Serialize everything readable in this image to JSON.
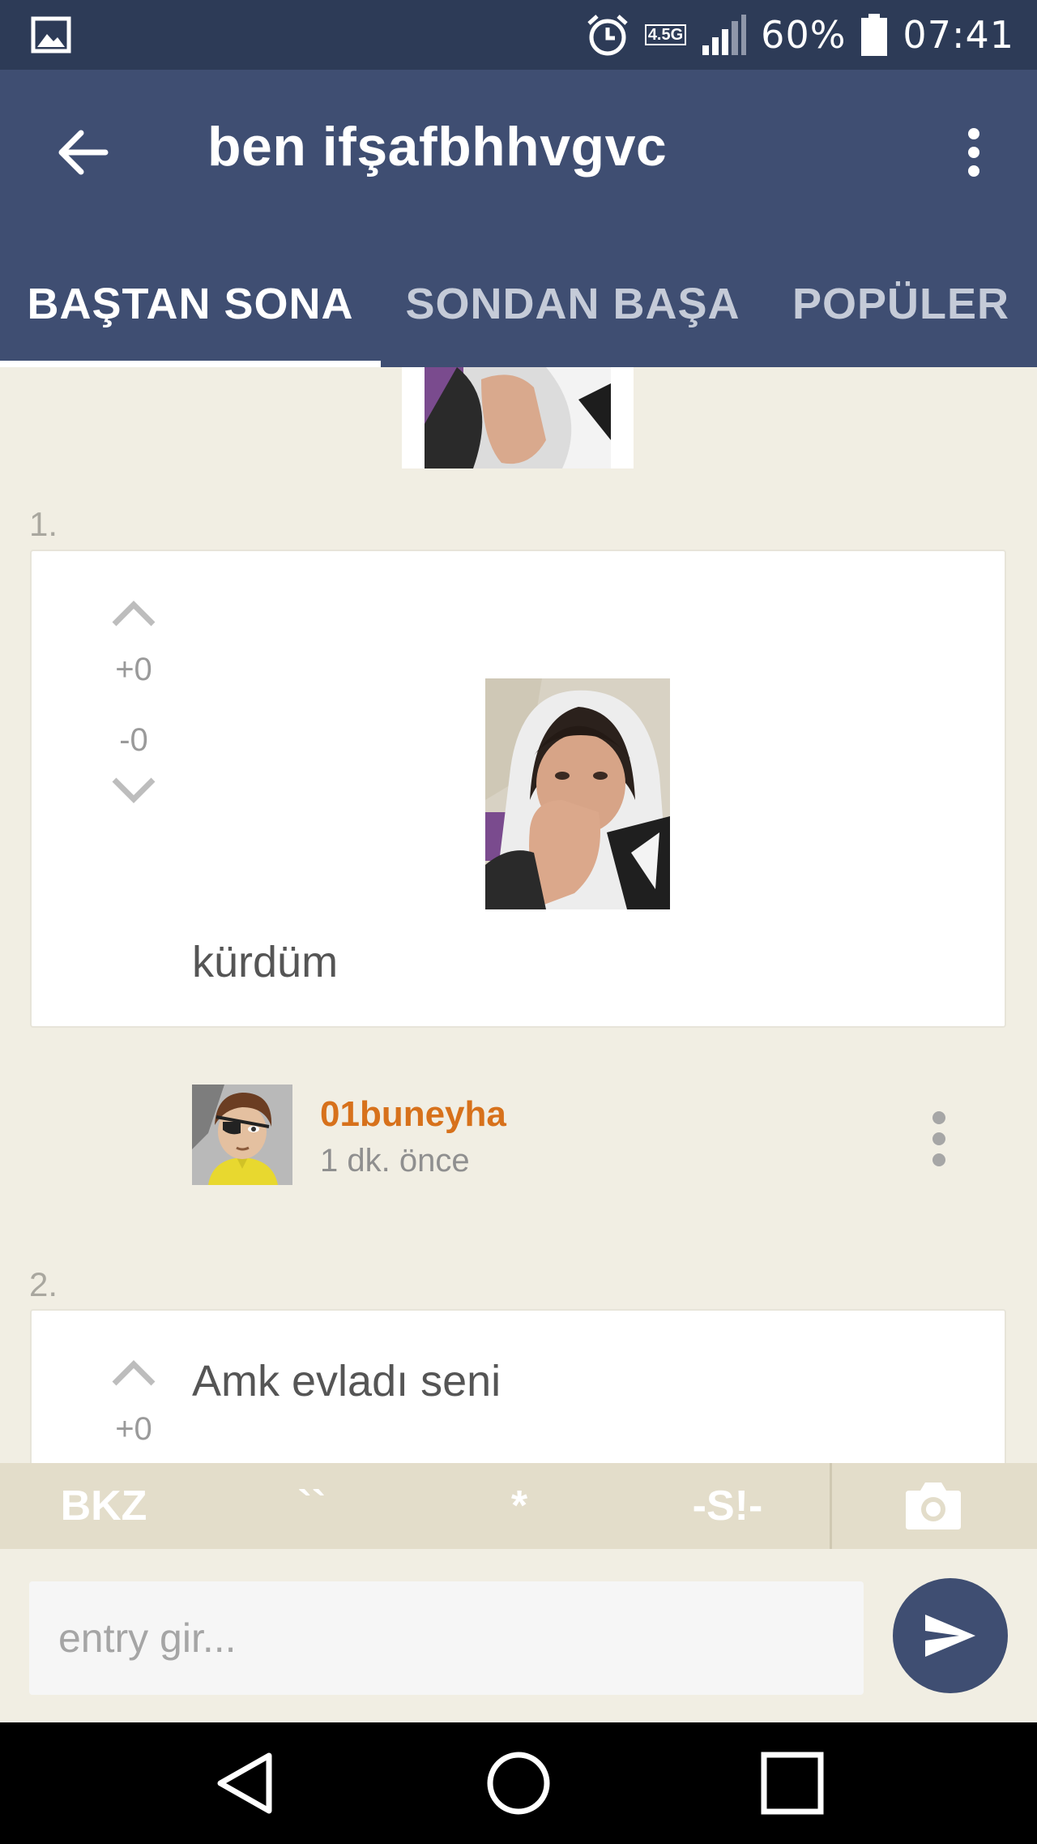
{
  "status_bar": {
    "network": "4.5G",
    "battery": "60%",
    "time": "07:41"
  },
  "app_bar": {
    "title": "ben ifşafbhhvgvc"
  },
  "tabs": [
    {
      "label": "BAŞTAN SONA",
      "active": true
    },
    {
      "label": "SONDAN BAŞA",
      "active": false
    },
    {
      "label": "POPÜLER",
      "active": false
    }
  ],
  "entries": [
    {
      "index": "1.",
      "upvotes": "+0",
      "downvotes": "-0",
      "text": "kürdüm",
      "author": "01buneyha",
      "time": "1 dk. önce"
    },
    {
      "index": "2.",
      "upvotes": "+0",
      "text": "Amk evladı seni"
    }
  ],
  "toolbar": {
    "bkz": "BKZ",
    "backtick": "``",
    "star": "*",
    "spoiler": "-S!-"
  },
  "composer": {
    "placeholder": "entry gir..."
  },
  "colors": {
    "status_bar": "#2d3b57",
    "app_bar": "#3f4e72",
    "page_bg": "#f1eee3",
    "author": "#d7711b",
    "toolbar": "#e3ddca"
  },
  "icons": {
    "status": [
      "gallery-icon",
      "alarm-icon",
      "signal-icon",
      "battery-icon"
    ],
    "app_bar": [
      "back-arrow-icon",
      "more-vert-icon"
    ],
    "entry": [
      "upvote-chevron-icon",
      "downvote-chevron-icon",
      "more-vert-icon"
    ],
    "toolbar": [
      "camera-icon"
    ],
    "composer": [
      "send-icon"
    ],
    "nav": [
      "back-triangle-icon",
      "home-circle-icon",
      "recents-square-icon"
    ]
  }
}
